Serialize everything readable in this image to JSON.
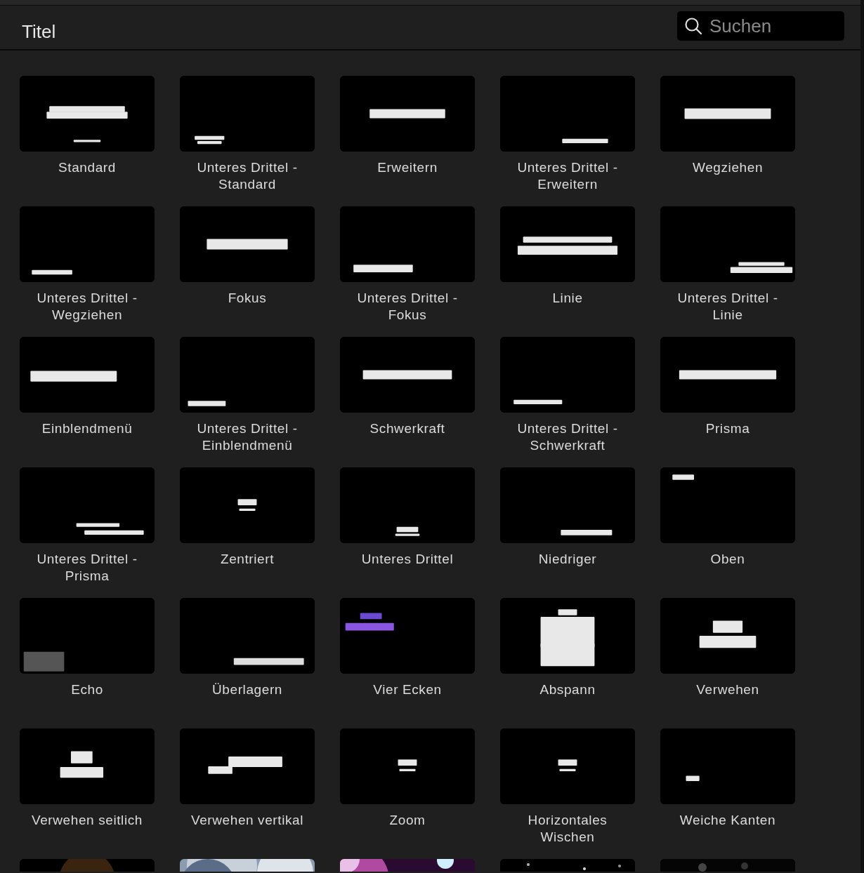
{
  "header": {
    "title": "Titel",
    "search": {
      "placeholder": "Suchen"
    }
  },
  "tiles": [
    {
      "label": "Standard"
    },
    {
      "label": "Unteres Drittel - Standard"
    },
    {
      "label": "Erweitern"
    },
    {
      "label": "Unteres Drittel - Erweitern"
    },
    {
      "label": "Wegziehen"
    },
    {
      "label": "Unteres Drittel - Wegziehen"
    },
    {
      "label": "Fokus"
    },
    {
      "label": "Unteres Drittel - Fokus"
    },
    {
      "label": "Linie"
    },
    {
      "label": "Unteres Drittel - Linie"
    },
    {
      "label": "Einblendmenü"
    },
    {
      "label": "Unteres Drittel - Einblendmenü"
    },
    {
      "label": "Schwerkraft"
    },
    {
      "label": "Unteres Drittel - Schwerkraft"
    },
    {
      "label": "Prisma"
    },
    {
      "label": "Unteres Drittel - Prisma"
    },
    {
      "label": "Zentriert"
    },
    {
      "label": "Unteres Drittel"
    },
    {
      "label": "Niedriger"
    },
    {
      "label": "Oben"
    },
    {
      "label": "Echo"
    },
    {
      "label": "Überlagern"
    },
    {
      "label": "Vier Ecken"
    },
    {
      "label": "Abspann"
    },
    {
      "label": "Verwehen"
    },
    {
      "label": "Verwehen seitlich"
    },
    {
      "label": "Verwehen vertikal"
    },
    {
      "label": "Zoom"
    },
    {
      "label": "Horizontales Wischen"
    },
    {
      "label": "Weiche Kanten"
    }
  ]
}
